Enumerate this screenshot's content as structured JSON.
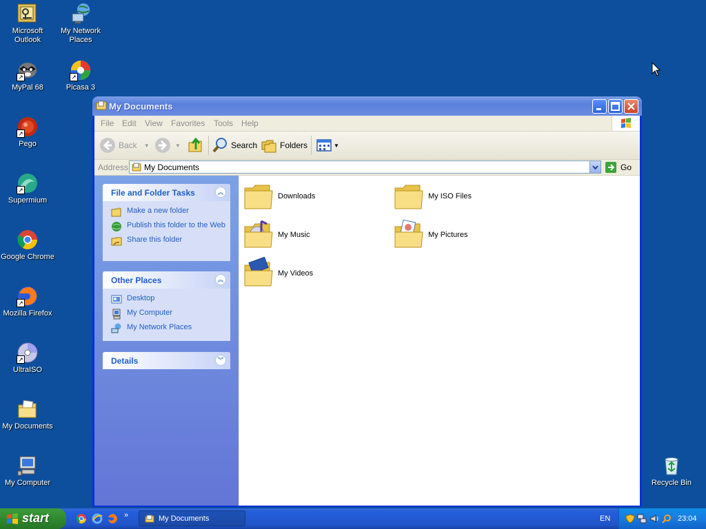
{
  "desktop": {
    "icons": [
      {
        "label": "Microsoft Outlook"
      },
      {
        "label": "My Network Places"
      },
      {
        "label": "MyPal 68"
      },
      {
        "label": "Picasa 3"
      },
      {
        "label": "Pego"
      },
      {
        "label": "Supermium"
      },
      {
        "label": "Google Chrome"
      },
      {
        "label": "Mozilla Firefox"
      },
      {
        "label": "UltraISO"
      },
      {
        "label": "My Documents"
      },
      {
        "label": "My Computer"
      },
      {
        "label": "Recycle Bin"
      }
    ]
  },
  "window": {
    "title": "My Documents",
    "menu": [
      "File",
      "Edit",
      "View",
      "Favorites",
      "Tools",
      "Help"
    ],
    "toolbar": {
      "back": "Back",
      "search": "Search",
      "folders": "Folders"
    },
    "address": {
      "label": "Address",
      "value": "My Documents",
      "go": "Go"
    },
    "tasks": {
      "file_folder": {
        "title": "File and Folder Tasks",
        "items": [
          "Make a new folder",
          "Publish this folder to the Web",
          "Share this folder"
        ]
      },
      "other_places": {
        "title": "Other Places",
        "items": [
          "Desktop",
          "My Computer",
          "My Network Places"
        ]
      },
      "details": {
        "title": "Details"
      }
    },
    "files": [
      {
        "name": "Downloads"
      },
      {
        "name": "My ISO Files"
      },
      {
        "name": "My Music"
      },
      {
        "name": "My Pictures"
      },
      {
        "name": "My Videos"
      }
    ]
  },
  "taskbar": {
    "start": "start",
    "task_button": "My Documents",
    "language": "EN",
    "clock": "23:04"
  },
  "colors": {
    "desktop": "#0d4f9c",
    "title_bar": "#6c8ee0",
    "link": "#215dc6",
    "start_green": "#2f8a2f"
  }
}
